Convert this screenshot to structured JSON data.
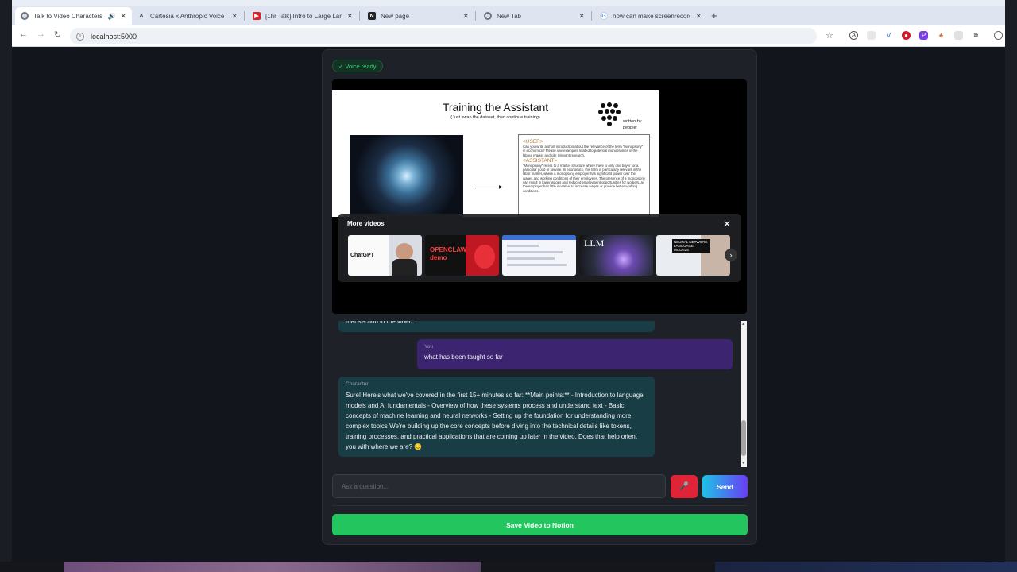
{
  "browser": {
    "tabs": [
      {
        "title": "Talk to Video Characters",
        "active": true,
        "favicon": "globe-icon",
        "audio": true
      },
      {
        "title": "Cartesia x Anthropic Voice Age",
        "active": false,
        "favicon": "cartesia-icon"
      },
      {
        "title": "[1hr Talk] Intro to Large Langu",
        "active": false,
        "favicon": "youtube-icon"
      },
      {
        "title": "New page",
        "active": false,
        "favicon": "notion-icon"
      },
      {
        "title": "New Tab",
        "active": false,
        "favicon": "globe-icon"
      },
      {
        "title": "how can make screenrecord of",
        "active": false,
        "favicon": "google-icon"
      }
    ],
    "url": "localhost:5000"
  },
  "app": {
    "voice_status": "✓ Voice ready",
    "video": {
      "slide_title": "Training the Assistant",
      "slide_subtitle": "(Just swap the dataset, then continue training)",
      "slide_written_by": "written by people:",
      "slide_user_tag": "<USER>",
      "slide_user_text": "Can you write a short introduction about the relevance of the term \"monopsony\" in economics? Please use examples related to potential monopsonies in the labour market and cite relevant research.",
      "slide_assistant_tag": "<ASSISTANT>",
      "slide_assistant_text": "\"Monopsony\" refers to a market structure where there is only one buyer for a particular good or service. In economics, this term is particularly relevant in the labor market, where a monopsony employer has significant power over the wages and working conditions of their employees. The presence of a monopsony can result in lower wages and reduced employment opportunities for workers, as the employer has little incentive to increase wages or provide better working conditions.",
      "more_videos_title": "More videos",
      "thumbnails": [
        {
          "label": "ChatGPT"
        },
        {
          "label": "OPENCLAW demo"
        },
        {
          "label": ""
        },
        {
          "label": "LLM"
        },
        {
          "label": "NEURAL NETWORK LANGUAGE MODELS"
        }
      ]
    },
    "chat": {
      "prev_fragment": "that section in the video.",
      "user_sender": "You",
      "user_message": "what has been taught so far",
      "char_sender": "Character",
      "char_message": "Sure! Here's what we've covered in the first 15+ minutes so far: **Main points:** - Introduction to language models and AI fundamentals - Overview of how these systems process and understand text - Basic concepts of machine learning and neural networks - Setting up the foundation for understanding more complex topics We're building up the core concepts before diving into the technical details like tokens, training processes, and practical applications that are coming up later in the video. Does that help orient you with where we are? 😊"
    },
    "input": {
      "placeholder": "Ask a question...",
      "value": ""
    },
    "mic_icon": "microphone-icon",
    "send_label": "Send",
    "notion_label": "Save Video to Notion"
  },
  "colors": {
    "accent_green": "#22c55e",
    "mic_red": "#e02437",
    "user_bubble": "#3c2470",
    "character_bubble": "#193d44"
  }
}
